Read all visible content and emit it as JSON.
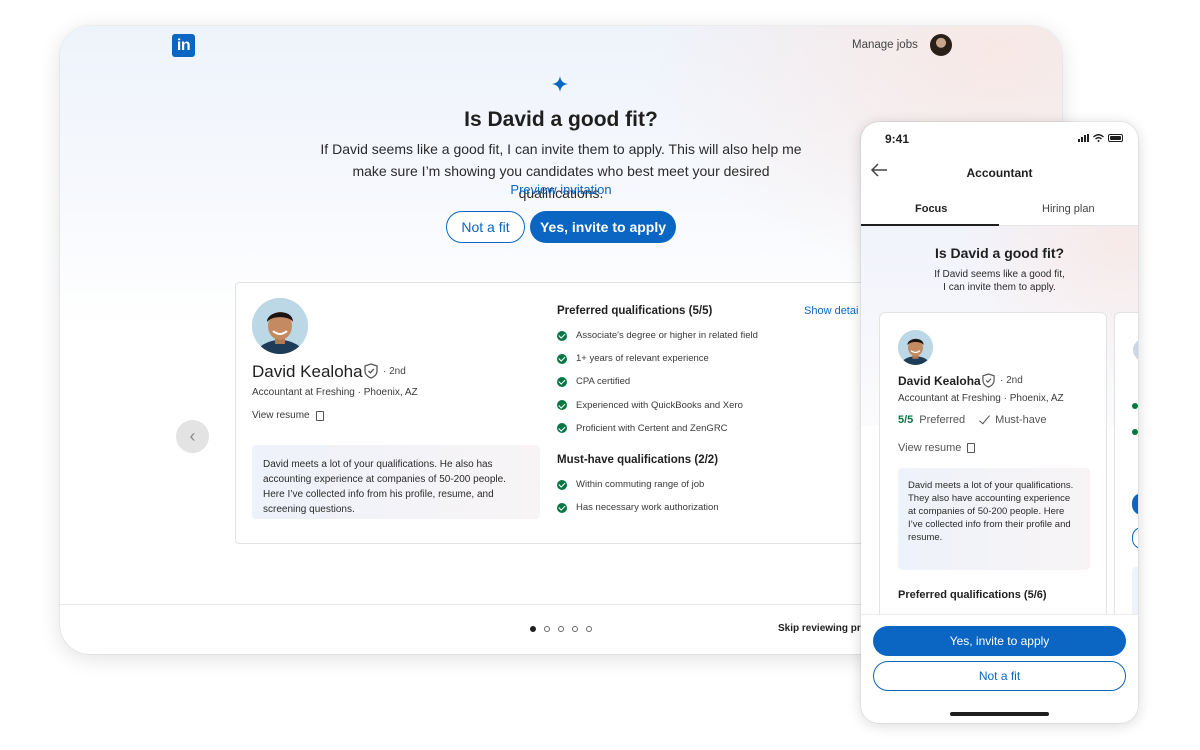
{
  "header": {
    "logo_text": "in",
    "manage_jobs": "Manage jobs"
  },
  "prompt": {
    "title": "Is David a good fit?",
    "subtitle": "If David seems like a good fit, I can invite them to apply. This will also help me make sure I’m showing you candidates who best meet your desired qualifications.",
    "preview_link": "Preview invitation",
    "not_fit_label": "Not a fit",
    "invite_label": "Yes, invite to apply"
  },
  "nav": {
    "prev_glyph": "‹"
  },
  "candidate": {
    "name": "David Kealoha",
    "degree": "· 2nd",
    "role": "Accountant at Freshing · Phoenix, AZ",
    "view_resume": "View resume",
    "summary": "David meets a lot of your qualifications. He also has accounting experience at companies of 50-200 people. Here I’ve collected info from his profile, resume, and screening questions."
  },
  "preferred": {
    "heading": "Preferred qualifications (5/5)",
    "show_details": "Show detai",
    "items": [
      "Associate's degree or higher in related field",
      "1+ years of relevant experience",
      "CPA certified",
      "Experienced with QuickBooks and Xero",
      "Proficient with Certent and ZenGRC"
    ]
  },
  "must_have": {
    "heading": "Must-have qualifications (2/2)",
    "items": [
      "Within commuting range of job",
      "Has necessary work authorization"
    ]
  },
  "footer": {
    "dots_total": 5,
    "dots_active": 1,
    "skip": "Skip reviewing pr"
  },
  "phone": {
    "time": "9:41",
    "title": "Accountant",
    "tabs": [
      "Focus",
      "Hiring plan"
    ],
    "question": "Is David a good fit?",
    "subtitle_line1": "If David seems like a good fit,",
    "subtitle_line2": "I can invite them to apply.",
    "card": {
      "name": "David Kealoha",
      "degree": "· 2nd",
      "role": "Accountant at Freshing · Phoenix, AZ",
      "match_count": "5/5",
      "match_label": "Preferred",
      "must_label": "Must-have",
      "view_resume": "View resume",
      "summary": "David meets a lot of your qualifications. They also have accounting experience at companies of 50-200 people. Here I’ve collected info from their profile and resume.",
      "preferred_heading": "Preferred qualifications (5/6)"
    },
    "invite_label": "Yes, invite to apply",
    "not_fit_label": "Not a fit"
  },
  "colors": {
    "brand": "#0a66c2",
    "success": "#057642",
    "text": "#1f1f1f"
  }
}
